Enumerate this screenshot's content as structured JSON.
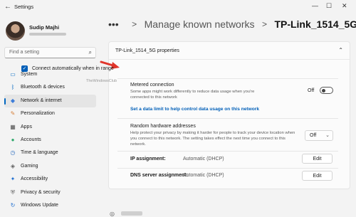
{
  "window": {
    "title": "Settings",
    "icons": {
      "back": "back-arrow-icon",
      "minimize": "minimize-icon",
      "maximize": "maximize-icon",
      "close": "close-icon"
    }
  },
  "profile": {
    "name": "Sudip Majhi"
  },
  "search": {
    "placeholder": "Find a setting",
    "icon": "search-icon"
  },
  "sidebar": {
    "items": [
      {
        "label": "System",
        "icon": "monitor-icon",
        "color": "#0067c0",
        "active": false
      },
      {
        "label": "Bluetooth & devices",
        "icon": "bluetooth-icon",
        "color": "#0067c0",
        "active": false
      },
      {
        "label": "Network & internet",
        "icon": "wifi-icon",
        "color": "#3d7dd8",
        "active": true
      },
      {
        "label": "Personalization",
        "icon": "brush-icon",
        "color": "#d6803b",
        "active": false
      },
      {
        "label": "Apps",
        "icon": "apps-icon",
        "color": "#505050",
        "active": false
      },
      {
        "label": "Accounts",
        "icon": "person-icon",
        "color": "#2ea86b",
        "active": false
      },
      {
        "label": "Time & language",
        "icon": "clock-globe-icon",
        "color": "#2f6fbf",
        "active": false
      },
      {
        "label": "Gaming",
        "icon": "gamepad-icon",
        "color": "#606060",
        "active": false
      },
      {
        "label": "Accessibility",
        "icon": "accessibility-icon",
        "color": "#1f6fd1",
        "active": false
      },
      {
        "label": "Privacy & security",
        "icon": "shield-icon",
        "color": "#606060",
        "active": false
      },
      {
        "label": "Windows Update",
        "icon": "refresh-icon",
        "color": "#1f6fd1",
        "active": false
      }
    ]
  },
  "breadcrumb": {
    "more": "•••",
    "separator": ">",
    "parent": "Manage known networks",
    "current": "TP-Link_1514_5G"
  },
  "section": {
    "title": "TP-Link_1514_5G properties"
  },
  "auto_connect": {
    "label": "Connect automatically when in range",
    "checked": true
  },
  "watermark": "TheWindowsClub",
  "metered": {
    "title": "Metered connection",
    "description_line1": "Some apps might work differently to reduce data usage when you're",
    "description_line2": "connected to this network",
    "toggle_label": "Off",
    "toggle_on": false,
    "link": "Set a data limit to help control data usage on this network"
  },
  "random_hw": {
    "title": "Random hardware addresses",
    "description_line1": "Help protect your privacy by making it harder for people to track your device location when",
    "description_line2": "you connect to this network. The setting takes effect the next time you connect to this",
    "description_line3": "network.",
    "value": "Off"
  },
  "ip": {
    "label": "IP assignment:",
    "value": "Automatic (DHCP)",
    "button": "Edit"
  },
  "dns": {
    "label": "DNS server assignment:",
    "value": "Automatic (DHCP)",
    "button": "Edit"
  },
  "colors": {
    "accent": "#005fb8",
    "annotation_arrow": "#e0352b"
  }
}
